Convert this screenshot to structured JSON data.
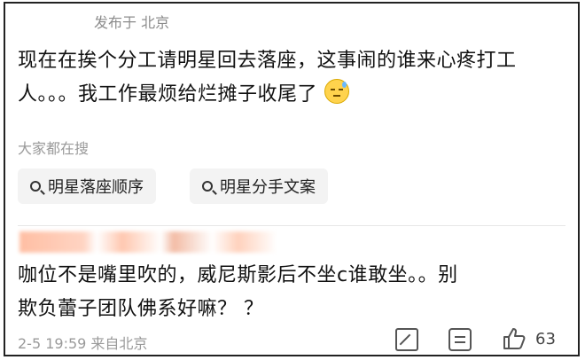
{
  "post": {
    "location": "发布于 北京",
    "line1": "现在在挨个分工请明星回去落座，这事闹的谁来心疼打工",
    "line2": "人。。。我工作最烦给烂摊子收尾了",
    "emoji": "sweat-smile-emoji"
  },
  "trending": {
    "title": "大家都在搜",
    "chips": [
      {
        "label": "明星落座顺序"
      },
      {
        "label": "明星分手文案"
      }
    ]
  },
  "reply": {
    "line1": "咖位不是嘴里吹的，威尼斯影后不坐c谁敢坐。。别",
    "line2": "欺负蕾子团队佛系好嘛？ ？",
    "meta": "2-5 19:59 来自北京",
    "like_count": "63"
  }
}
